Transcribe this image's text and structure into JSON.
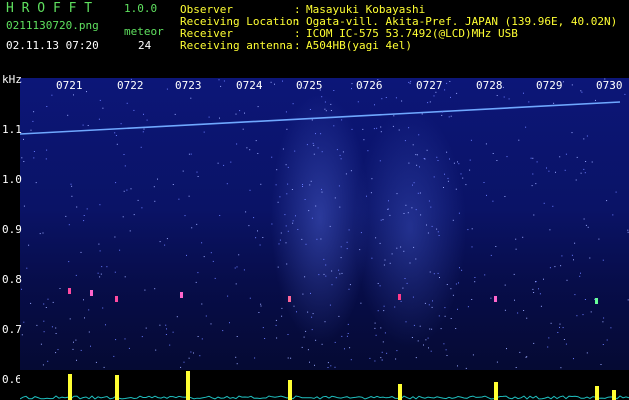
{
  "header": {
    "app_name": "H R O F F T",
    "version": "1.0.0",
    "filename": "0211130720.png",
    "datetime": "02.11.13 07:20",
    "meteor_label": "meteor",
    "meteor_count": "24",
    "fields": [
      {
        "label": "Observer",
        "sep": ":",
        "value": "Masayuki Kobayashi"
      },
      {
        "label": "Receiving Location",
        "sep": ":",
        "value": "Ogata-vill. Akita-Pref. JAPAN (139.96E, 40.02N)"
      },
      {
        "label": "Receiver",
        "sep": ":",
        "value": "ICOM IC-575 53.7492(@LCD)MHz USB"
      },
      {
        "label": "Receiving antenna",
        "sep": ":",
        "value": "A504HB(yagi 4el)"
      }
    ]
  },
  "axis": {
    "unit": "kHz",
    "y_ticks": [
      {
        "label": "1.1",
        "value": 1.1
      },
      {
        "label": "1.0",
        "value": 1.0
      },
      {
        "label": "0.9",
        "value": 0.9
      },
      {
        "label": "0.8",
        "value": 0.8
      },
      {
        "label": "0.7",
        "value": 0.7
      },
      {
        "label": "0.6",
        "value": 0.6
      }
    ],
    "time_labels": [
      "0721",
      "0722",
      "0723",
      "0724",
      "0725",
      "0726",
      "0727",
      "0728",
      "0729",
      "0730"
    ]
  },
  "colors": {
    "background": "#000000",
    "waterfall": "#0a1366",
    "tone_line": "#6fa8ff",
    "spectrum_bar": "#ffff33",
    "noise_floor": "#20c0c0",
    "header_green": "#5fe05f"
  }
}
